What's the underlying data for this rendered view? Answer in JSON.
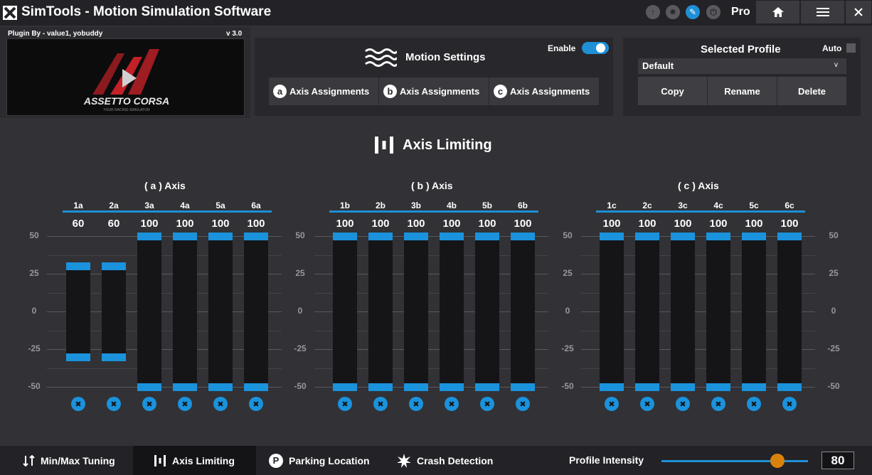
{
  "app": {
    "title": "SimTools - Motion Simulation Software",
    "edition": "Pro"
  },
  "titlebar_icons": [
    {
      "name": "upload-icon",
      "glyph": "↑"
    },
    {
      "name": "crash-icon",
      "glyph": "✹"
    },
    {
      "name": "tune-icon",
      "glyph": "✎"
    },
    {
      "name": "power-icon",
      "glyph": "⏻"
    }
  ],
  "plugin": {
    "by": "Plugin By - value1, yobuddy",
    "version": "v 3.0",
    "game_logo_text": "ASSETTO CORSA",
    "game_logo_sub": "YOUR RACING SIMULATOR"
  },
  "motion": {
    "title": "Motion Settings",
    "enable_label": "Enable",
    "enabled": true,
    "axis_buttons": [
      {
        "badge": "a",
        "label": "Axis Assignments"
      },
      {
        "badge": "b",
        "label": "Axis Assignments"
      },
      {
        "badge": "c",
        "label": "Axis Assignments"
      }
    ]
  },
  "profile": {
    "title": "Selected Profile",
    "auto_label": "Auto",
    "auto_checked": false,
    "selected": "Default",
    "caret": "v",
    "buttons": [
      "Copy",
      "Rename",
      "Delete"
    ]
  },
  "section_title": "Axis Limiting",
  "scale_ticks": [
    "50",
    "25",
    "0",
    "-25",
    "-50"
  ],
  "axis_groups": [
    {
      "title": "( a ) Axis",
      "columns": [
        {
          "label": "1a",
          "value": "60",
          "max": 30,
          "min": -30
        },
        {
          "label": "2a",
          "value": "60",
          "max": 30,
          "min": -30
        },
        {
          "label": "3a",
          "value": "100",
          "max": 50,
          "min": -50
        },
        {
          "label": "4a",
          "value": "100",
          "max": 50,
          "min": -50
        },
        {
          "label": "5a",
          "value": "100",
          "max": 50,
          "min": -50
        },
        {
          "label": "6a",
          "value": "100",
          "max": 50,
          "min": -50
        }
      ]
    },
    {
      "title": "( b ) Axis",
      "columns": [
        {
          "label": "1b",
          "value": "100",
          "max": 50,
          "min": -50
        },
        {
          "label": "2b",
          "value": "100",
          "max": 50,
          "min": -50
        },
        {
          "label": "3b",
          "value": "100",
          "max": 50,
          "min": -50
        },
        {
          "label": "4b",
          "value": "100",
          "max": 50,
          "min": -50
        },
        {
          "label": "5b",
          "value": "100",
          "max": 50,
          "min": -50
        },
        {
          "label": "6b",
          "value": "100",
          "max": 50,
          "min": -50
        }
      ]
    },
    {
      "title": "( c ) Axis",
      "columns": [
        {
          "label": "1c",
          "value": "100",
          "max": 50,
          "min": -50
        },
        {
          "label": "2c",
          "value": "100",
          "max": 50,
          "min": -50
        },
        {
          "label": "3c",
          "value": "100",
          "max": 50,
          "min": -50
        },
        {
          "label": "4c",
          "value": "100",
          "max": 50,
          "min": -50
        },
        {
          "label": "5c",
          "value": "100",
          "max": 50,
          "min": -50
        },
        {
          "label": "6c",
          "value": "100",
          "max": 50,
          "min": -50
        }
      ]
    }
  ],
  "reset_glyph": "✖",
  "nav": {
    "tabs": [
      {
        "label": "Min/Max Tuning",
        "icon": "minmax-icon",
        "active": false
      },
      {
        "label": "Axis Limiting",
        "icon": "axis-limit-icon",
        "active": true
      },
      {
        "label": "Parking Location",
        "icon": "parking-icon",
        "active": false
      },
      {
        "label": "Crash Detection",
        "icon": "crash-icon",
        "active": false
      }
    ],
    "intensity_label": "Profile Intensity",
    "intensity_value": "80",
    "intensity_fraction": 0.8
  },
  "colors": {
    "accent": "#1a92dc",
    "slider_knob": "#d9820b",
    "background": "#323135"
  }
}
